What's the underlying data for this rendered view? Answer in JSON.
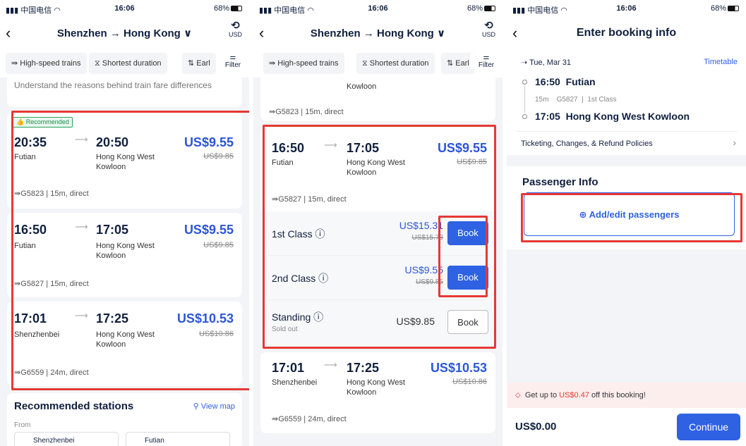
{
  "status": {
    "carrier": "中国电信",
    "time": "16:06",
    "battery": "68%"
  },
  "p1": {
    "route": "Shenzhen → Hong Kong ∨",
    "currency": "USD",
    "filters": [
      "High-speed trains",
      "Shortest duration",
      "Earl",
      "Filter"
    ],
    "info_text": "Understand the reasons behind train fare differences",
    "recommended_badge": "Recommended",
    "trains": [
      {
        "dep_time": "20:35",
        "dep_station": "Futian",
        "arr_time": "20:50",
        "arr_station": "Hong Kong West Kowloon",
        "price": "US$9.55",
        "old_price": "US$9.85",
        "meta": "G5823 | 15m, direct"
      },
      {
        "dep_time": "16:50",
        "dep_station": "Futian",
        "arr_time": "17:05",
        "arr_station": "Hong Kong West Kowloon",
        "price": "US$9.55",
        "old_price": "US$9.85",
        "meta": "G5827 | 15m, direct"
      },
      {
        "dep_time": "17:01",
        "dep_station": "Shenzhenbei",
        "arr_time": "17:25",
        "arr_station": "Hong Kong West Kowloon",
        "price": "US$10.53",
        "old_price": "US$10.86",
        "meta": "G6559 | 24m, direct"
      }
    ],
    "rec_title": "Recommended stations",
    "view_map": "View map",
    "from_label": "From",
    "st1": "Shenzhenbei",
    "st2": "Futian"
  },
  "p2": {
    "route": "Shenzhen → Hong Kong ∨",
    "currency": "USD",
    "filters": [
      "High-speed trains",
      "Shortest duration",
      "Earl",
      "Filter"
    ],
    "prev_station": "Kowloon",
    "prev_meta": "G5823 | 15m, direct",
    "train": {
      "dep_time": "16:50",
      "dep_station": "Futian",
      "arr_time": "17:05",
      "arr_station": "Hong Kong West Kowloon",
      "price": "US$9.55",
      "old_price": "US$9.85",
      "meta": "G5827 | 15m, direct"
    },
    "classes": [
      {
        "name": "1st Class",
        "price": "US$15.31",
        "old": "US$15.78",
        "book": "Book",
        "sold": ""
      },
      {
        "name": "2nd Class",
        "price": "US$9.55",
        "old": "US$9.85",
        "book": "Book",
        "sold": ""
      },
      {
        "name": "Standing",
        "price": "US$9.85",
        "old": "",
        "book": "Book",
        "sold": "Sold out"
      }
    ],
    "next": {
      "dep_time": "17:01",
      "dep_station": "Shenzhenbei",
      "arr_time": "17:25",
      "arr_station": "Hong Kong West Kowloon",
      "price": "US$10.53",
      "old_price": "US$10.86",
      "meta": "G6559 | 24m, direct"
    }
  },
  "p3": {
    "title": "Enter booking info",
    "date": "Tue, Mar 31",
    "timetable": "Timetable",
    "dep_time": "16:50",
    "dep_station": "Futian",
    "duration": "15m",
    "train_no": "G5827",
    "class": "1st Class",
    "arr_time": "17:05",
    "arr_station": "Hong Kong West Kowloon",
    "policies": "Ticketing, Changes, & Refund Policies",
    "passenger_title": "Passenger Info",
    "add_passengers": "Add/edit passengers",
    "promo_pre": "Get up to ",
    "promo_amt": "US$0.47",
    "promo_post": " off this booking!",
    "total": "US$0.00",
    "continue": "Continue"
  },
  "colors": {
    "accent": "#2f61e3",
    "highlight": "#e53935",
    "price": "#2c55d8"
  }
}
